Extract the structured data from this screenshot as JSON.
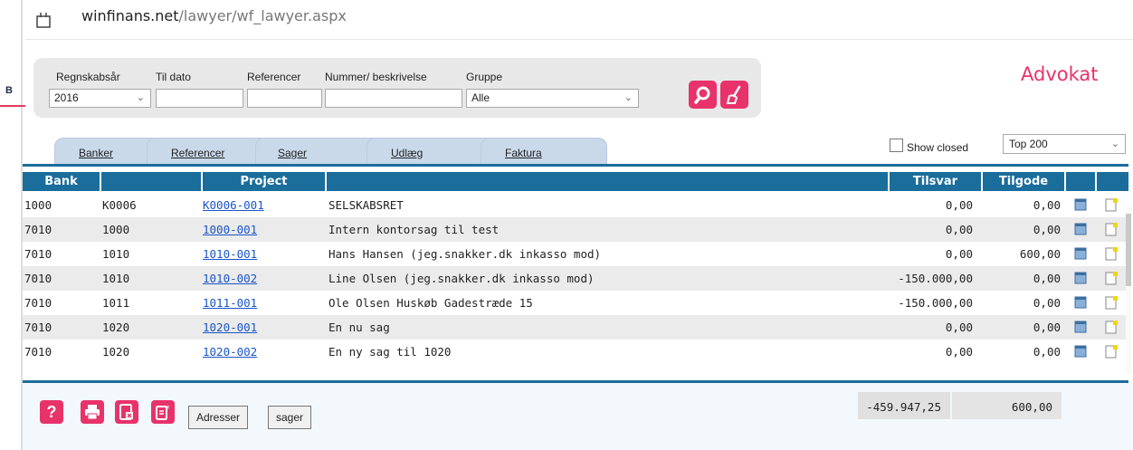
{
  "browser": {
    "url_domain": "winfinans.net",
    "url_path": "/lawyer/wf_lawyer.aspx"
  },
  "side": {
    "letter": "B"
  },
  "filters": {
    "regnskabsaar": {
      "label": "Regnskabsår",
      "value": "2016"
    },
    "til_dato": {
      "label": "Til dato",
      "value": ""
    },
    "referencer": {
      "label": "Referencer",
      "value": ""
    },
    "nummer": {
      "label": "Nummer/ beskrivelse",
      "value": ""
    },
    "gruppe": {
      "label": "Gruppe",
      "value": "Alle"
    }
  },
  "brand": "Advokat",
  "tabs": [
    {
      "label": "Banker",
      "active": false
    },
    {
      "label": "Referencer",
      "active": false
    },
    {
      "label": "Sager",
      "active": true
    },
    {
      "label": "Udlæg",
      "active": false
    },
    {
      "label": "Faktura",
      "active": false
    }
  ],
  "show_closed": {
    "label": "Show closed",
    "checked": false
  },
  "top_select": {
    "value": "Top 200"
  },
  "table": {
    "headers": {
      "bank": "Bank",
      "client": "",
      "project": "Project",
      "description": "",
      "tilsvar": "Tilsvar",
      "tilgode": "Tilgode"
    },
    "rows": [
      {
        "bank": "1000",
        "client": "K0006",
        "project": "K0006-001",
        "description": "SELSKABSRET",
        "tilsvar": "0,00",
        "tilgode": "0,00"
      },
      {
        "bank": "7010",
        "client": "1000",
        "project": "1000-001",
        "description": "Intern kontorsag til test",
        "tilsvar": "0,00",
        "tilgode": "0,00"
      },
      {
        "bank": "7010",
        "client": "1010",
        "project": "1010-001",
        "description": "Hans Hansen (jeg.snakker.dk inkasso mod)",
        "tilsvar": "0,00",
        "tilgode": "600,00"
      },
      {
        "bank": "7010",
        "client": "1010",
        "project": "1010-002",
        "description": "Line Olsen (jeg.snakker.dk inkasso mod)",
        "tilsvar": "-150.000,00",
        "tilgode": "0,00"
      },
      {
        "bank": "7010",
        "client": "1011",
        "project": "1011-001",
        "description": "Ole Olsen Huskøb Gadestræde 15",
        "tilsvar": "-150.000,00",
        "tilgode": "0,00"
      },
      {
        "bank": "7010",
        "client": "1020",
        "project": "1020-001",
        "description": "En nu sag",
        "tilsvar": "0,00",
        "tilgode": "0,00"
      },
      {
        "bank": "7010",
        "client": "1020",
        "project": "1020-002",
        "description": "En ny sag til 1020",
        "tilsvar": "0,00",
        "tilgode": "0,00"
      }
    ]
  },
  "footer": {
    "adresser_label": "Adresser",
    "sager_label": "sager",
    "total_tilsvar": "-459.947,25",
    "total_tilgode": "600,00"
  },
  "colors": {
    "accent": "#e8336a",
    "header_blue": "#1b6d9b",
    "tab_inactive": "#c9d9ea",
    "link": "#1a55c8"
  }
}
